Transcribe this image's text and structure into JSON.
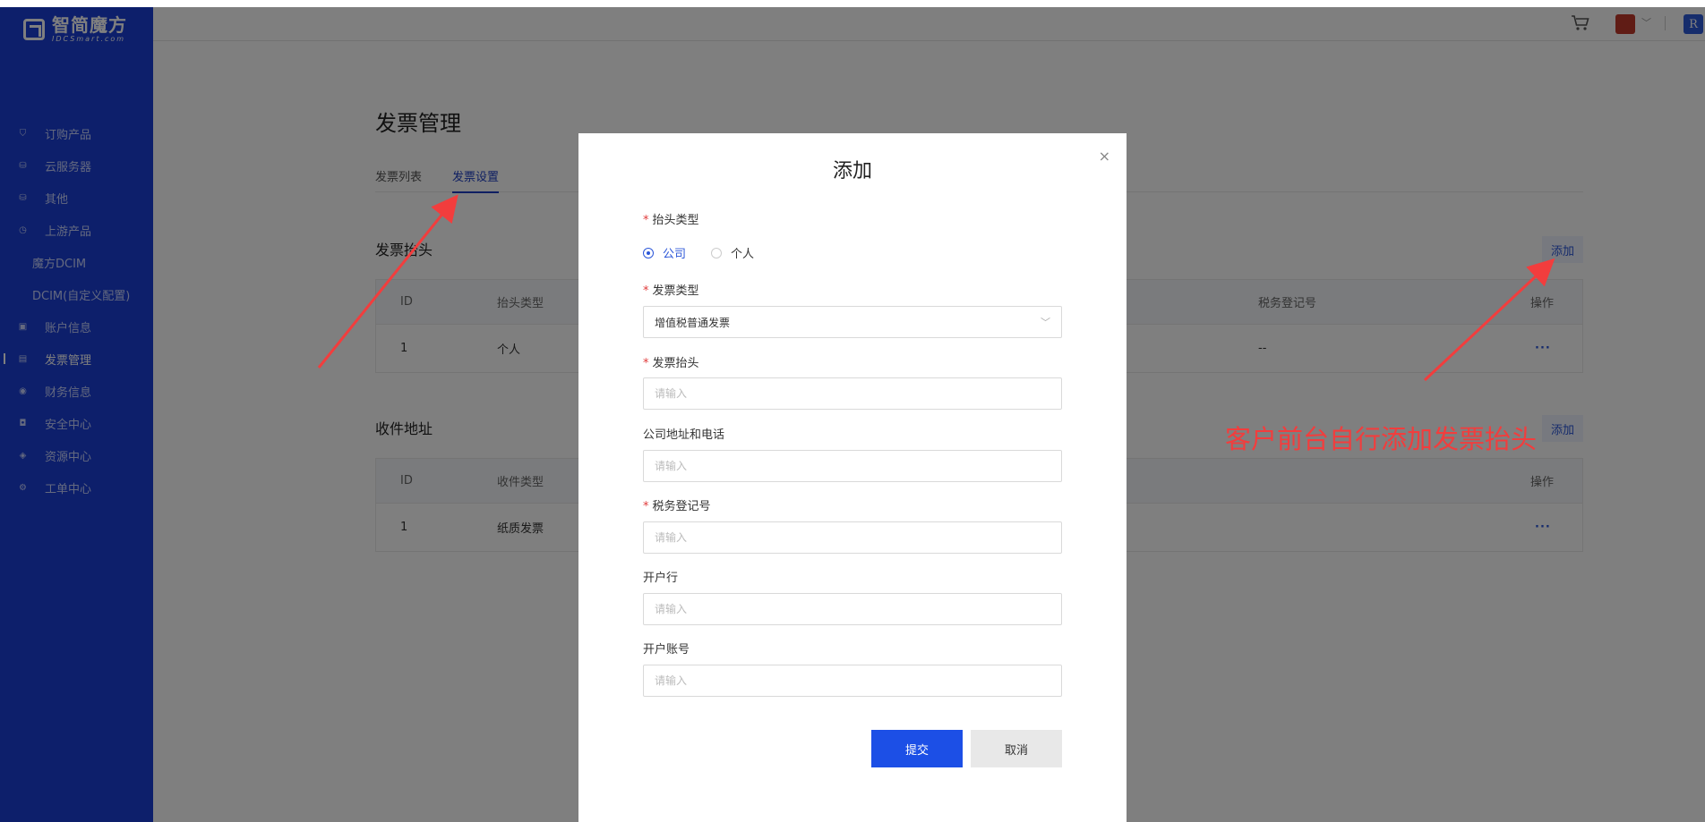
{
  "brand": {
    "name": "智简魔方",
    "sub": "IDCSmart.com"
  },
  "sidebar": {
    "items": [
      {
        "label": "订购产品",
        "icon": "cart-icon"
      },
      {
        "label": "云服务器",
        "icon": "server-icon"
      },
      {
        "label": "其他",
        "icon": "server-icon"
      },
      {
        "label": "上游产品",
        "icon": "clock-icon"
      },
      {
        "label": "魔方DCIM",
        "icon": ""
      },
      {
        "label": "DCIM(自定义配置)",
        "icon": ""
      },
      {
        "label": "账户信息",
        "icon": "user-card-icon"
      },
      {
        "label": "发票管理",
        "icon": "invoice-icon"
      },
      {
        "label": "财务信息",
        "icon": "finance-icon"
      },
      {
        "label": "安全中心",
        "icon": "lock-icon"
      },
      {
        "label": "资源中心",
        "icon": "tag-icon"
      },
      {
        "label": "工单中心",
        "icon": "ticket-icon"
      }
    ]
  },
  "topbar": {
    "user_initial": "R"
  },
  "page": {
    "title": "发票管理",
    "tabs": [
      "发票列表",
      "发票设置"
    ],
    "add_label": "添加",
    "invoice_header": {
      "title": "发票抬头",
      "columns": [
        "ID",
        "抬头类型",
        "税务登记号",
        "操作"
      ],
      "rows": [
        {
          "id": "1",
          "type": "个人",
          "tax": "--",
          "op": "···"
        }
      ]
    },
    "address": {
      "title": "收件地址",
      "columns": [
        "ID",
        "收件类型",
        "操作"
      ],
      "rows": [
        {
          "id": "1",
          "type": "纸质发票",
          "op": "···"
        }
      ]
    }
  },
  "annotation": {
    "text": "客户前台自行添加发票抬头",
    "color": "#f23d3d"
  },
  "dialog": {
    "title": "添加",
    "close": "×",
    "header_type_label": "抬头类型",
    "header_type_options": [
      "公司",
      "个人"
    ],
    "invoice_type_label": "发票类型",
    "invoice_type_value": "增值税普通发票",
    "invoice_title_label": "发票抬头",
    "address_phone_label": "公司地址和电话",
    "tax_no_label": "税务登记号",
    "bank_label": "开户行",
    "account_label": "开户账号",
    "placeholder": "请输入",
    "submit": "提交",
    "cancel": "取消"
  }
}
